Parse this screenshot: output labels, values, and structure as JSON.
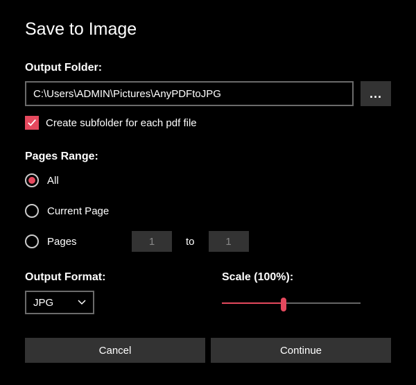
{
  "dialog": {
    "title": "Save to Image",
    "output_folder_label": "Output Folder:",
    "output_folder_value": "C:\\Users\\ADMIN\\Pictures\\AnyPDFtoJPG",
    "browse_label": "...",
    "subfolder_checkbox_label": "Create subfolder for each pdf file",
    "pages_range_label": "Pages Range:",
    "radio_all": "All",
    "radio_current": "Current Page",
    "radio_pages": "Pages",
    "page_from": "1",
    "page_to_label": "to",
    "page_to": "1",
    "output_format_label": "Output Format:",
    "output_format_value": "JPG",
    "scale_label": "Scale (100%):",
    "cancel_label": "Cancel",
    "continue_label": "Continue"
  }
}
